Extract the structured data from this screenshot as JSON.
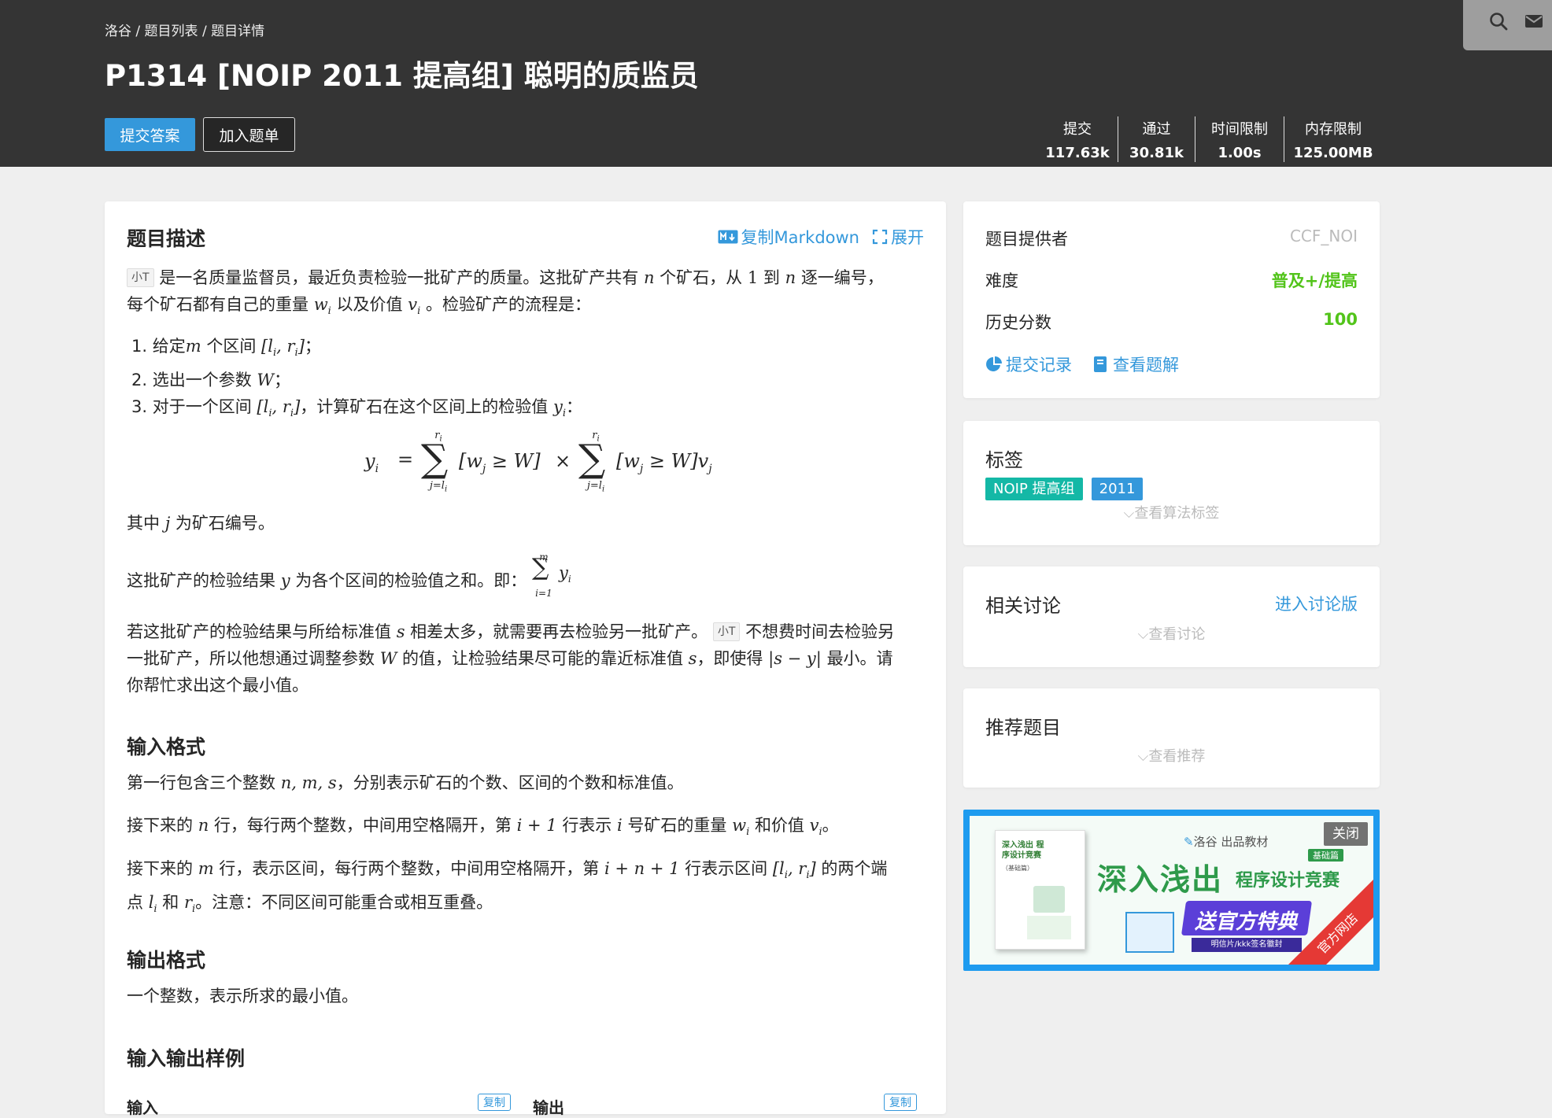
{
  "breadcrumb": {
    "items": [
      "洛谷",
      "题目列表",
      "题目详情"
    ],
    "sep": "/"
  },
  "title": "P1314 [NOIP 2011 提高组] 聪明的质监员",
  "actions": {
    "submit": "提交答案",
    "add_list": "加入题单"
  },
  "stats": [
    {
      "label": "提交",
      "value": "117.63k"
    },
    {
      "label": "通过",
      "value": "30.81k"
    },
    {
      "label": "时间限制",
      "value": "1.00s"
    },
    {
      "label": "内存限制",
      "value": "125.00MB"
    }
  ],
  "colors": {
    "header": "#343434",
    "accent": "#3498db",
    "green": "#52c41a",
    "teal": "#14b8a6"
  },
  "description": {
    "heading": "题目描述",
    "copy_md": "复制Markdown",
    "expand": "展开",
    "user_tag": "小T",
    "p1a": "是一名质量监督员，最近负责检验一批矿产的质量。这批矿产共有",
    "p1b": "个矿石，从",
    "p1c": "到",
    "p1d": "逐一编号，",
    "p2a": "每个矿石都有自己的重量",
    "p2b": "以及价值",
    "p2c": "。检验矿产的流程是：",
    "list": [
      {
        "n": "1.",
        "a": "给定",
        "b": "个区间",
        "c": "；"
      },
      {
        "n": "2.",
        "a": "选出一个参数",
        "c": "；"
      },
      {
        "n": "3.",
        "a": "对于一个区间",
        "b": "，计算矿石在这个区间上的检验值",
        "c": "："
      }
    ],
    "p3a": "其中",
    "p3b": "为矿石编号。",
    "p4a": "这批矿产的检验结果",
    "p4b": "为各个区间的检验值之和。即：",
    "p5a": "若这批矿产的检验结果与所给标准值",
    "p5b": "相差太多，就需要再去检验另一批矿产。",
    "p5c": "不想费时间去检验另",
    "p6a": "一批矿产，所以他想通过调整参数",
    "p6b": "的值，让检验结果尽可能的靠近标准值",
    "p6c": "，即使得",
    "p6d": "最小。请",
    "p7": "你帮忙求出这个最小值。"
  },
  "math": {
    "n": "n",
    "one": "1",
    "m": "m",
    "W": "W",
    "j": "j",
    "y": "y",
    "s": "s",
    "w_i": "w",
    "v_i": "v",
    "sub_i": "i",
    "sub_j": "j",
    "interval": "[l",
    "interval_mid": ", r",
    "interval_end": "]",
    "yi": "y",
    "formula_lhs": "y",
    "formula_eq": "=",
    "sum_top": "r",
    "sum_bot": "j=l",
    "bracket": "[w",
    "ge": "≥ W]",
    "times": "×",
    "vj": "v",
    "abs": "|s − y|",
    "sum2_top": "m",
    "sum2_bot": "i=1"
  },
  "input_format": {
    "heading": "输入格式",
    "l1a": "第一行包含三个整数",
    "l1m": "n, m, s",
    "l1b": "，分别表示矿石的个数、区间的个数和标准值。",
    "l2a": "接下来的",
    "l2b": "行，每行两个整数，中间用空格隔开，第",
    "l2m": "i + 1",
    "l2c": "行表示",
    "l2d": "号矿石的重量",
    "l2e": "和价值",
    "l2f": "。",
    "l3a": "接下来的",
    "l3b": "行，表示区间，每行两个整数，中间用空格隔开，第",
    "l3m": "i + n + 1",
    "l3c": "行表示区间",
    "l3d": "的两个端",
    "l4a": "点",
    "l4b": "和",
    "l4c": "。注意：不同区间可能重合或相互重叠。"
  },
  "output_format": {
    "heading": "输出格式",
    "text": "一个整数，表示所求的最小值。"
  },
  "samples": {
    "heading": "输入输出样例",
    "in": "输入",
    "out": "输出",
    "copy": "复制"
  },
  "info": {
    "provider_label": "题目提供者",
    "provider_value": "CCF_NOI",
    "difficulty_label": "难度",
    "difficulty_value": "普及+/提高",
    "score_label": "历史分数",
    "score_value": "100",
    "records": "提交记录",
    "solutions": "查看题解"
  },
  "tags_card": {
    "title": "标签",
    "tags": [
      "NOIP 提高组",
      "2011"
    ],
    "more": "查看算法标签"
  },
  "discuss_card": {
    "title": "相关讨论",
    "link": "进入讨论版",
    "more": "查看讨论"
  },
  "recommend_card": {
    "title": "推荐题目",
    "more": "查看推荐"
  },
  "ad": {
    "brand": "洛谷 出品教材",
    "headline": "深入浅出",
    "subline": "程序设计竞赛",
    "edition": "基础篇",
    "promo": "送官方特典",
    "promo_sub": "明信片/kkk签名徽封",
    "corner": "官方网店",
    "close": "关闭",
    "book_title": "深入浅出 程序设计竞赛",
    "book_sub": "（基础篇）"
  }
}
